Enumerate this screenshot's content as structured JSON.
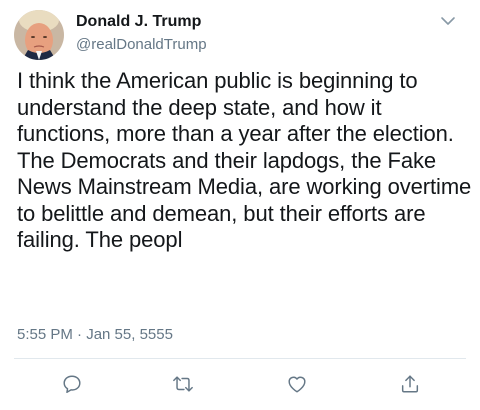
{
  "author": {
    "name": "Donald J. Trump",
    "handle": "@realDonaldTrump"
  },
  "tweet": {
    "text": "I think the American public is beginning to understand the deep state, and how it functions, more than a year after the election. The Democrats and their lapdogs, the Fake News Mainstream Media, are working overtime to belittle and demean, but their efforts are failing. The peopl",
    "timestamp": "5:55 PM · Jan 55, 5555"
  },
  "icons": {
    "menu": "chevron-down-icon",
    "reply": "reply-icon",
    "retweet": "retweet-icon",
    "like": "heart-icon",
    "share": "share-icon"
  },
  "colors": {
    "text": "#14171a",
    "secondary": "#657786",
    "divider": "#e1e8ed"
  }
}
